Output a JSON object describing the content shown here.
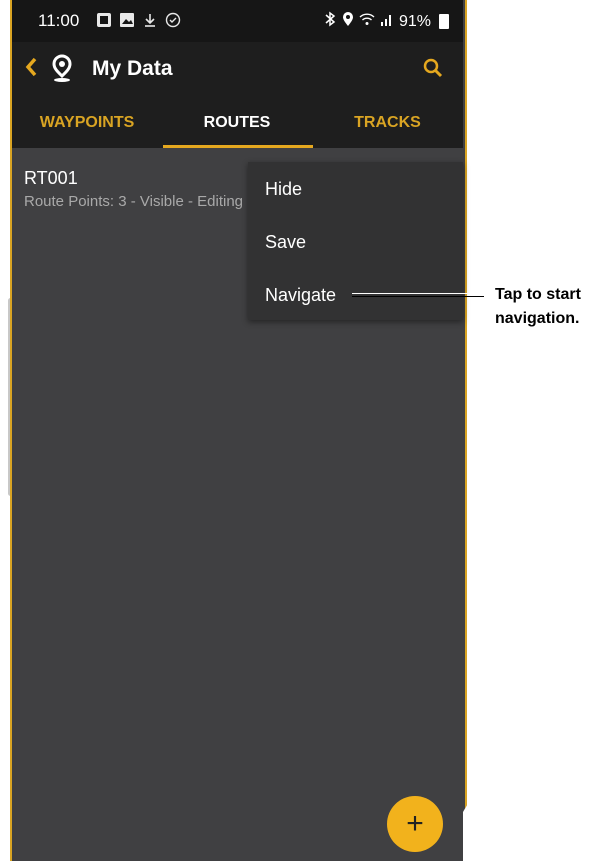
{
  "status_bar": {
    "time": "11:00",
    "battery": "91%",
    "left_icons": [
      "notification-icon",
      "image-icon",
      "download-icon",
      "check-circle-icon"
    ],
    "right_icons": [
      "bluetooth-icon",
      "location-icon",
      "wifi-icon",
      "signal-icon"
    ]
  },
  "app_bar": {
    "title": "My Data",
    "back_icon": "chevron-left-icon",
    "pin_icon": "map-pin-icon",
    "search_icon": "search-icon"
  },
  "tabs": [
    {
      "label": "WAYPOINTS",
      "active": false
    },
    {
      "label": "ROUTES",
      "active": true
    },
    {
      "label": "TRACKS",
      "active": false
    }
  ],
  "route": {
    "name": "RT001",
    "subtitle": "Route Points: 3 - Visible - Editing"
  },
  "menu": {
    "items": [
      {
        "label": "Hide"
      },
      {
        "label": "Save"
      },
      {
        "label": "Navigate"
      }
    ]
  },
  "callout": {
    "line1": "Tap to start",
    "line2": "navigation."
  },
  "fab": {
    "label": "+"
  },
  "colors": {
    "accent": "#e5a81f",
    "background": "#404042",
    "bar": "#1e1e1e",
    "menu": "#323233"
  }
}
